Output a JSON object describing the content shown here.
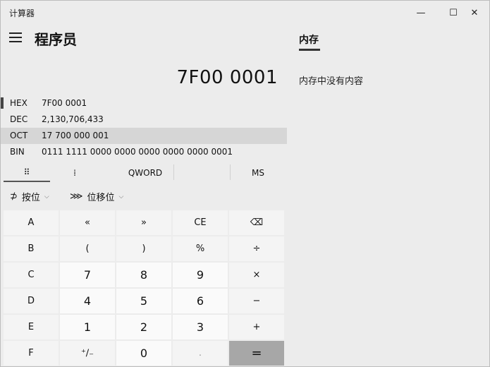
{
  "titlebar": {
    "app_title": "计算器",
    "minimize": "—",
    "maximize": "☐",
    "close": "✕"
  },
  "header": {
    "mode_title": "程序员"
  },
  "display": {
    "value": "7F00 0001"
  },
  "radix": [
    {
      "name": "HEX",
      "value": "7F00 0001",
      "active": true
    },
    {
      "name": "DEC",
      "value": "2,130,706,433"
    },
    {
      "name": "OCT",
      "value": "17 700 000 001",
      "highlighted": true
    },
    {
      "name": "BIN",
      "value": "0111 1111 0000 0000 0000 0000 0000 0001"
    }
  ],
  "tabs": {
    "keypad_icon": "⠿",
    "bits_icon": "⁞",
    "word_size": "QWORD",
    "ms": "MS"
  },
  "ops": {
    "bitwise": "按位",
    "bitshift": "位移位",
    "bitwise_icon": "⊅",
    "bitshift_icon": "⋙",
    "chevron": "⌵"
  },
  "keys": {
    "r0": [
      "A",
      "«",
      "»",
      "CE",
      "⌫"
    ],
    "r1": [
      "B",
      "(",
      ")",
      "%",
      "÷"
    ],
    "r2": [
      "C",
      "7",
      "8",
      "9",
      "×"
    ],
    "r3": [
      "D",
      "4",
      "5",
      "6",
      "−"
    ],
    "r4": [
      "E",
      "1",
      "2",
      "3",
      "+"
    ],
    "r5": [
      "F",
      "⁺∕₋",
      "0",
      ".",
      "="
    ]
  },
  "memory": {
    "tab_label": "内存",
    "empty_text": "内存中没有内容"
  },
  "colors": {
    "background": "#ececec",
    "key": "#f4f4f4",
    "number_key": "#fafafa",
    "equals_key": "#a7a7a7",
    "selected_row": "#d6d6d6"
  }
}
